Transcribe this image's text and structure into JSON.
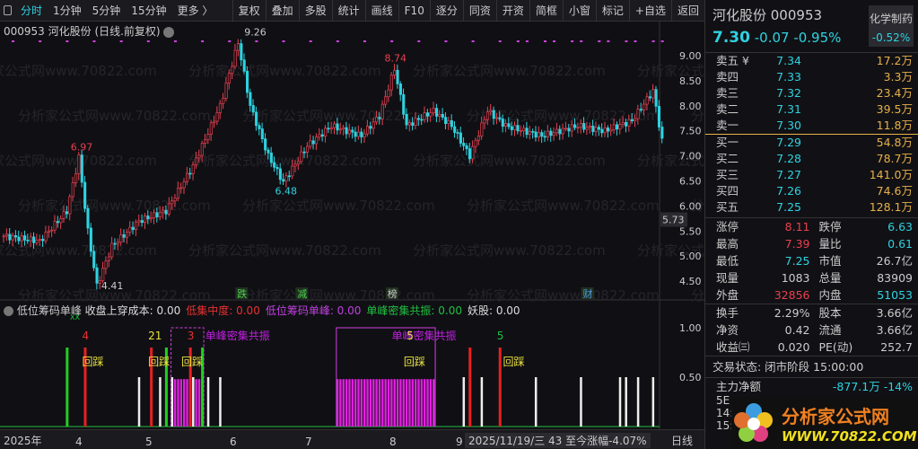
{
  "toolbar": {
    "left": [
      "分时",
      "1分钟",
      "5分钟",
      "15分钟",
      "更多 〉"
    ],
    "right": [
      "复权",
      "叠加",
      "多股",
      "统计",
      "画线",
      "F10",
      "逐分",
      "同资",
      "开资",
      "简框",
      "小窗",
      "标记",
      "+自选",
      "返回"
    ]
  },
  "chart_title": "000953 河化股份 (日线.前复权)",
  "watermark": "分析家公式网www.70822.com",
  "price_axis": [
    "9.00",
    "8.50",
    "8.00",
    "7.50",
    "7.00",
    "6.50",
    "6.00",
    "5.50",
    "5.00",
    "4.50"
  ],
  "current_price_tag": "5.73",
  "annotations": {
    "high": "9.26",
    "peak2": "8.74",
    "peak1": "6.97",
    "low1": "4.41",
    "low2": "6.48"
  },
  "events": [
    "跌",
    "减",
    "榜",
    "财"
  ],
  "indicator": {
    "name": "低位筹码单峰",
    "items": [
      {
        "label": "收盘上穿成本: 0.00",
        "color": "#dddddd"
      },
      {
        "label": "低集中度: 0.00",
        "color": "#e83030"
      },
      {
        "label": "低位筹码单峰: 0.00",
        "color": "#c040e0"
      },
      {
        "label": "单峰密集共振: 0.00",
        "color": "#20c040"
      },
      {
        "label": "妖股: 0.00",
        "color": "#dddddd"
      }
    ],
    "axis": [
      "1.00",
      "0.50"
    ],
    "labels": [
      "4",
      "21",
      "3",
      "单峰密集共振",
      "单峰密集共振",
      "5",
      "5"
    ],
    "huicai": "回踩",
    "xx": "XX"
  },
  "date_axis": {
    "year": "2025年",
    "months": [
      "4",
      "5",
      "6",
      "7",
      "8",
      "9"
    ],
    "info": "2025/11/19/三 43 至今涨幅-4.07%",
    "period": "日线"
  },
  "quote": {
    "name": "河化股份 000953",
    "sector": "化学制药",
    "price": "7.30",
    "change": "-0.07",
    "pct": "-0.95%",
    "sector_pct": "-0.52%"
  },
  "asks": [
    [
      "卖五 ¥",
      "7.34",
      "17.2万"
    ],
    [
      "卖四",
      "7.33",
      "3.3万"
    ],
    [
      "卖三",
      "7.32",
      "23.4万"
    ],
    [
      "卖二",
      "7.31",
      "39.5万"
    ],
    [
      "卖一",
      "7.30",
      "11.8万"
    ]
  ],
  "bids": [
    [
      "买一",
      "7.29",
      "54.8万"
    ],
    [
      "买二",
      "7.28",
      "78.7万"
    ],
    [
      "买三",
      "7.27",
      "141.0万"
    ],
    [
      "买四",
      "7.26",
      "74.6万"
    ],
    [
      "买五",
      "7.25",
      "128.1万"
    ]
  ],
  "stats1": [
    [
      "涨停",
      "8.11",
      "跌停",
      "6.63"
    ],
    [
      "最高",
      "7.39",
      "量比",
      "0.61"
    ],
    [
      "最低",
      "7.25",
      "市值",
      "26.7亿"
    ],
    [
      "现量",
      "1083",
      "总量",
      "83909"
    ],
    [
      "外盘",
      "32856",
      "内盘",
      "51053"
    ]
  ],
  "stats2": [
    [
      "换手",
      "2.29%",
      "股本",
      "3.66亿"
    ],
    [
      "净资",
      "0.42",
      "流通",
      "3.66亿"
    ],
    [
      "收益㈢",
      "0.020",
      "PE(动)",
      "252.7"
    ]
  ],
  "trade_status": "交易状态: 闭市阶段 15:00:00",
  "main_flow": {
    "label": "主力净额",
    "value": "-877.1万 -14%"
  },
  "cut_rows": [
    "5E",
    "14:",
    "15:"
  ],
  "logo": {
    "text": "分析家公式网",
    "url": "WWW.70822.COM"
  },
  "chart_data": {
    "type": "candlestick",
    "xlim": [
      0,
      220
    ],
    "ylim": [
      4.3,
      9.3
    ],
    "keypoints": [
      [
        0,
        5.4
      ],
      [
        12,
        5.3
      ],
      [
        21,
        5.9
      ],
      [
        25,
        6.97
      ],
      [
        28,
        5.5
      ],
      [
        31,
        4.41
      ],
      [
        36,
        5.2
      ],
      [
        45,
        5.7
      ],
      [
        54,
        5.9
      ],
      [
        63,
        6.8
      ],
      [
        72,
        8.0
      ],
      [
        78,
        9.26
      ],
      [
        82,
        8.0
      ],
      [
        88,
        7.0
      ],
      [
        93,
        6.48
      ],
      [
        101,
        7.2
      ],
      [
        109,
        7.6
      ],
      [
        119,
        7.4
      ],
      [
        125,
        7.8
      ],
      [
        130,
        8.74
      ],
      [
        134,
        7.6
      ],
      [
        143,
        7.9
      ],
      [
        149,
        7.6
      ],
      [
        155,
        7.0
      ],
      [
        161,
        7.9
      ],
      [
        167,
        7.6
      ],
      [
        179,
        7.4
      ],
      [
        191,
        7.6
      ],
      [
        200,
        7.5
      ],
      [
        209,
        7.7
      ],
      [
        216,
        8.3
      ],
      [
        219,
        7.3
      ]
    ],
    "signals": {
      "white": [
        45,
        52,
        56,
        63,
        68,
        72,
        153,
        159,
        177,
        192,
        205,
        207,
        211,
        216
      ],
      "red": [
        27,
        49,
        62,
        155,
        165
      ],
      "green": [
        21,
        54,
        66
      ],
      "magenta_bands": [
        [
          56,
          66
        ],
        [
          111,
          143
        ]
      ]
    }
  }
}
